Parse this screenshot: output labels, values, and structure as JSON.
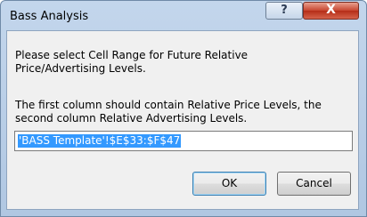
{
  "window": {
    "title": "Bass Analysis",
    "help_glyph": "?",
    "close_glyph": "X"
  },
  "dialog": {
    "prompt_line1": "Please select Cell Range for Future Relative",
    "prompt_line2": "Price/Advertising Levels.",
    "info_line1": "The first column should contain Relative Price Levels, the",
    "info_line2": "second column Relative Advertising Levels.",
    "range_value": "'BASS Template'!$E$33:$F$47",
    "ok_label": "OK",
    "cancel_label": "Cancel"
  },
  "icons": {
    "help": "help-icon",
    "close": "close-icon"
  },
  "colors": {
    "selection": "#3399ff",
    "close_button": "#c7452f"
  }
}
